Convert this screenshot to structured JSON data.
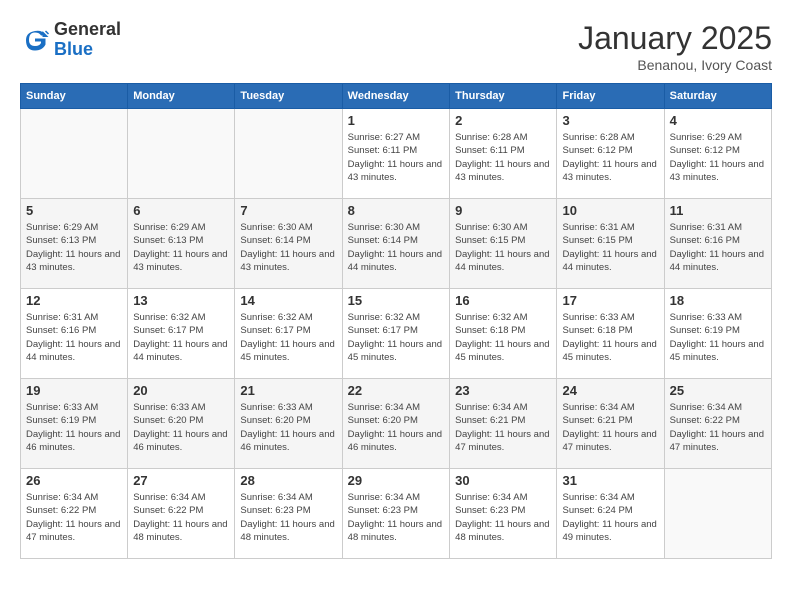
{
  "header": {
    "logo_general": "General",
    "logo_blue": "Blue",
    "month_title": "January 2025",
    "subtitle": "Benanou, Ivory Coast"
  },
  "weekdays": [
    "Sunday",
    "Monday",
    "Tuesday",
    "Wednesday",
    "Thursday",
    "Friday",
    "Saturday"
  ],
  "weeks": [
    [
      {
        "day": "",
        "empty": true
      },
      {
        "day": "",
        "empty": true
      },
      {
        "day": "",
        "empty": true
      },
      {
        "day": "1",
        "sunrise": "6:27 AM",
        "sunset": "6:11 PM",
        "daylight": "11 hours and 43 minutes."
      },
      {
        "day": "2",
        "sunrise": "6:28 AM",
        "sunset": "6:11 PM",
        "daylight": "11 hours and 43 minutes."
      },
      {
        "day": "3",
        "sunrise": "6:28 AM",
        "sunset": "6:12 PM",
        "daylight": "11 hours and 43 minutes."
      },
      {
        "day": "4",
        "sunrise": "6:29 AM",
        "sunset": "6:12 PM",
        "daylight": "11 hours and 43 minutes."
      }
    ],
    [
      {
        "day": "5",
        "sunrise": "6:29 AM",
        "sunset": "6:13 PM",
        "daylight": "11 hours and 43 minutes."
      },
      {
        "day": "6",
        "sunrise": "6:29 AM",
        "sunset": "6:13 PM",
        "daylight": "11 hours and 43 minutes."
      },
      {
        "day": "7",
        "sunrise": "6:30 AM",
        "sunset": "6:14 PM",
        "daylight": "11 hours and 43 minutes."
      },
      {
        "day": "8",
        "sunrise": "6:30 AM",
        "sunset": "6:14 PM",
        "daylight": "11 hours and 44 minutes."
      },
      {
        "day": "9",
        "sunrise": "6:30 AM",
        "sunset": "6:15 PM",
        "daylight": "11 hours and 44 minutes."
      },
      {
        "day": "10",
        "sunrise": "6:31 AM",
        "sunset": "6:15 PM",
        "daylight": "11 hours and 44 minutes."
      },
      {
        "day": "11",
        "sunrise": "6:31 AM",
        "sunset": "6:16 PM",
        "daylight": "11 hours and 44 minutes."
      }
    ],
    [
      {
        "day": "12",
        "sunrise": "6:31 AM",
        "sunset": "6:16 PM",
        "daylight": "11 hours and 44 minutes."
      },
      {
        "day": "13",
        "sunrise": "6:32 AM",
        "sunset": "6:17 PM",
        "daylight": "11 hours and 44 minutes."
      },
      {
        "day": "14",
        "sunrise": "6:32 AM",
        "sunset": "6:17 PM",
        "daylight": "11 hours and 45 minutes."
      },
      {
        "day": "15",
        "sunrise": "6:32 AM",
        "sunset": "6:17 PM",
        "daylight": "11 hours and 45 minutes."
      },
      {
        "day": "16",
        "sunrise": "6:32 AM",
        "sunset": "6:18 PM",
        "daylight": "11 hours and 45 minutes."
      },
      {
        "day": "17",
        "sunrise": "6:33 AM",
        "sunset": "6:18 PM",
        "daylight": "11 hours and 45 minutes."
      },
      {
        "day": "18",
        "sunrise": "6:33 AM",
        "sunset": "6:19 PM",
        "daylight": "11 hours and 45 minutes."
      }
    ],
    [
      {
        "day": "19",
        "sunrise": "6:33 AM",
        "sunset": "6:19 PM",
        "daylight": "11 hours and 46 minutes."
      },
      {
        "day": "20",
        "sunrise": "6:33 AM",
        "sunset": "6:20 PM",
        "daylight": "11 hours and 46 minutes."
      },
      {
        "day": "21",
        "sunrise": "6:33 AM",
        "sunset": "6:20 PM",
        "daylight": "11 hours and 46 minutes."
      },
      {
        "day": "22",
        "sunrise": "6:34 AM",
        "sunset": "6:20 PM",
        "daylight": "11 hours and 46 minutes."
      },
      {
        "day": "23",
        "sunrise": "6:34 AM",
        "sunset": "6:21 PM",
        "daylight": "11 hours and 47 minutes."
      },
      {
        "day": "24",
        "sunrise": "6:34 AM",
        "sunset": "6:21 PM",
        "daylight": "11 hours and 47 minutes."
      },
      {
        "day": "25",
        "sunrise": "6:34 AM",
        "sunset": "6:22 PM",
        "daylight": "11 hours and 47 minutes."
      }
    ],
    [
      {
        "day": "26",
        "sunrise": "6:34 AM",
        "sunset": "6:22 PM",
        "daylight": "11 hours and 47 minutes."
      },
      {
        "day": "27",
        "sunrise": "6:34 AM",
        "sunset": "6:22 PM",
        "daylight": "11 hours and 48 minutes."
      },
      {
        "day": "28",
        "sunrise": "6:34 AM",
        "sunset": "6:23 PM",
        "daylight": "11 hours and 48 minutes."
      },
      {
        "day": "29",
        "sunrise": "6:34 AM",
        "sunset": "6:23 PM",
        "daylight": "11 hours and 48 minutes."
      },
      {
        "day": "30",
        "sunrise": "6:34 AM",
        "sunset": "6:23 PM",
        "daylight": "11 hours and 48 minutes."
      },
      {
        "day": "31",
        "sunrise": "6:34 AM",
        "sunset": "6:24 PM",
        "daylight": "11 hours and 49 minutes."
      },
      {
        "day": "",
        "empty": true
      }
    ]
  ]
}
